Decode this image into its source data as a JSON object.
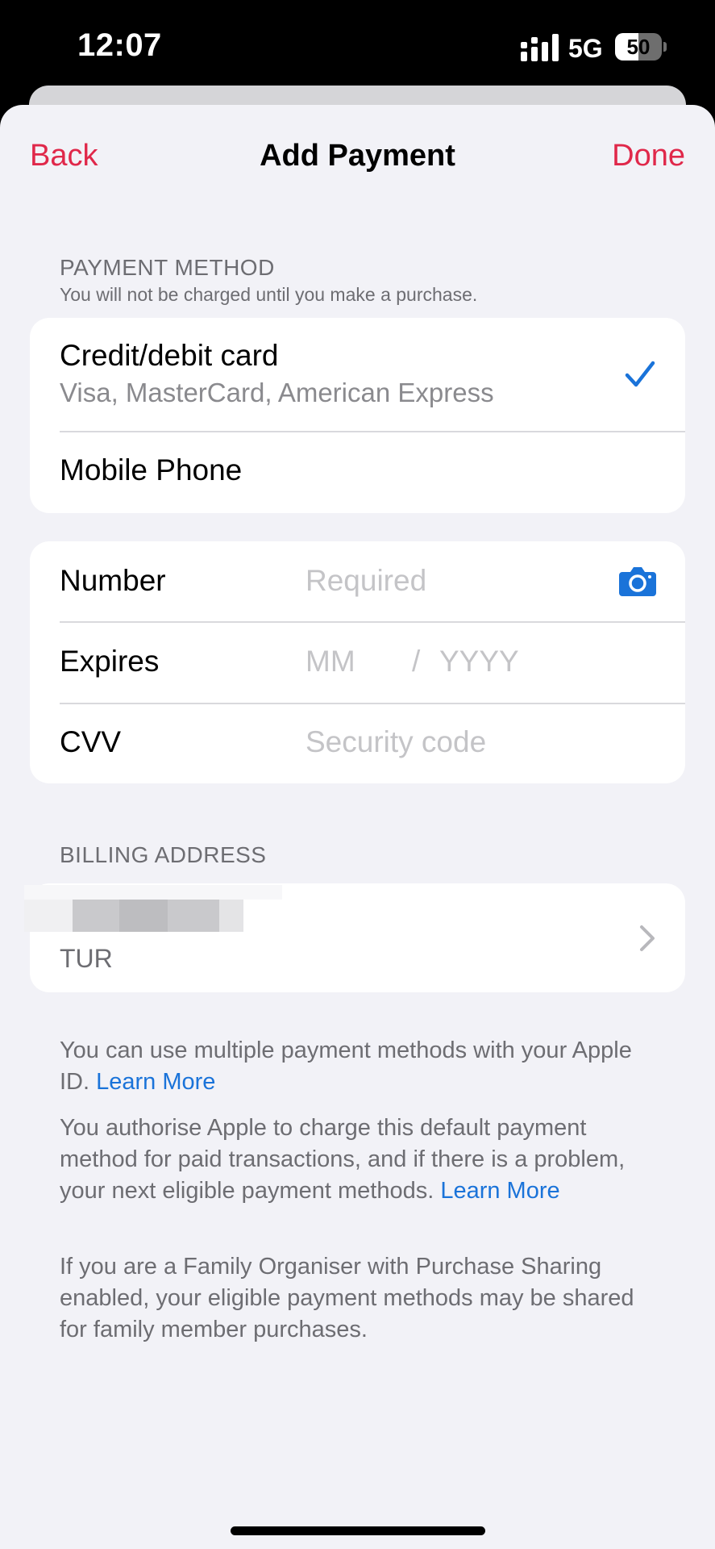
{
  "status_bar": {
    "time": "12:07",
    "network": "5G",
    "battery_percent": 50,
    "battery_label": "50",
    "signal_icon": "cellular-signal-icon"
  },
  "nav": {
    "back_label": "Back",
    "title": "Add Payment",
    "done_label": "Done"
  },
  "payment_method": {
    "header": "PAYMENT METHOD",
    "subheader": "You will not be charged until you make a purchase.",
    "options": [
      {
        "title": "Credit/debit card",
        "subtitle": "Visa, MasterCard, American Express",
        "selected": true
      },
      {
        "title": "Mobile Phone",
        "selected": false
      }
    ],
    "check_icon": "checkmark-icon"
  },
  "card_fields": {
    "number": {
      "label": "Number",
      "placeholder": "Required",
      "value": ""
    },
    "expires": {
      "label": "Expires",
      "month_placeholder": "MM",
      "separator": "/",
      "year_placeholder": "YYYY"
    },
    "cvv": {
      "label": "CVV",
      "placeholder": "Security code",
      "value": ""
    },
    "scan_icon": "camera-icon"
  },
  "billing": {
    "header": "BILLING ADDRESS",
    "country": "TUR",
    "chevron_icon": "chevron-right-icon"
  },
  "footer": {
    "p1_text": "You can use multiple payment methods with your Apple ID.",
    "p1_link": "Learn More",
    "p2_text": "You authorise Apple to charge this default payment method for paid transactions, and if there is a problem, your next eligible payment methods.",
    "p2_link": "Learn More",
    "p3_text": "If you are a Family Organiser with Purchase Sharing enabled, your eligible payment methods may be shared for family member purchases."
  },
  "colors": {
    "accent_red": "#e0284a",
    "link_blue": "#1a73d9",
    "check_blue": "#1a73d9",
    "background": "#f2f2f7"
  }
}
